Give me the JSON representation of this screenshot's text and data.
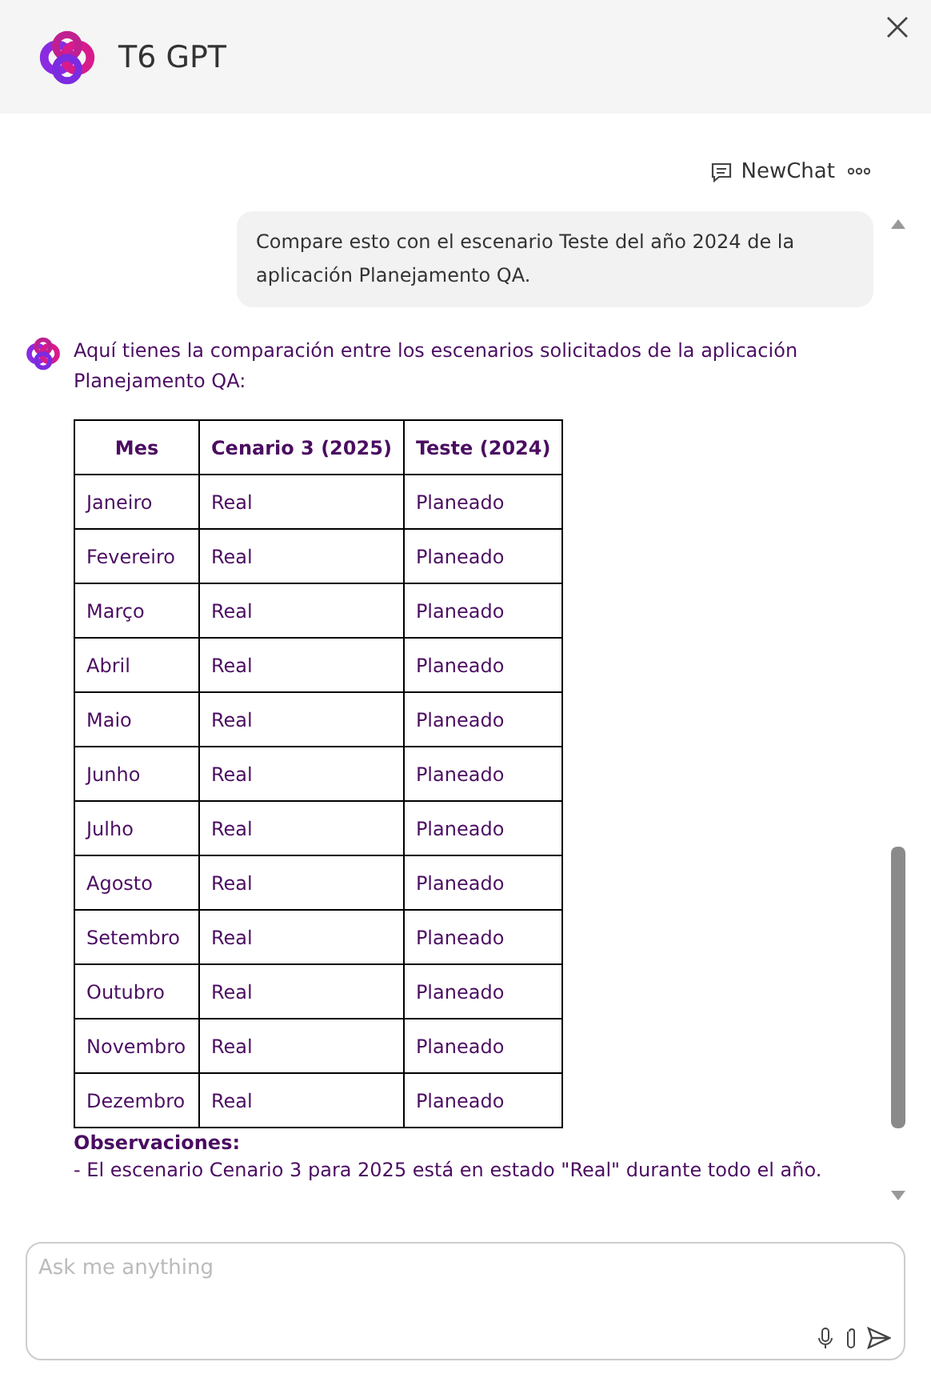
{
  "header": {
    "title": "T6 GPT"
  },
  "toolbar": {
    "new_chat": "NewChat"
  },
  "messages": [
    {
      "kind": "user",
      "text": "Compare esto con el escenario Teste del año 2024 de la aplicación Planejamento QA."
    },
    {
      "kind": "bot",
      "intro": "Aquí tienes la comparación entre los escenarios solicitados de la aplicación Planejamento QA:",
      "table": {
        "columns": [
          "Mes",
          "Cenario 3 (2025)",
          "Teste (2024)"
        ],
        "rows": [
          [
            "Janeiro",
            "Real",
            "Planeado"
          ],
          [
            "Fevereiro",
            "Real",
            "Planeado"
          ],
          [
            "Março",
            "Real",
            "Planeado"
          ],
          [
            "Abril",
            "Real",
            "Planeado"
          ],
          [
            "Maio",
            "Real",
            "Planeado"
          ],
          [
            "Junho",
            "Real",
            "Planeado"
          ],
          [
            "Julho",
            "Real",
            "Planeado"
          ],
          [
            "Agosto",
            "Real",
            "Planeado"
          ],
          [
            "Setembro",
            "Real",
            "Planeado"
          ],
          [
            "Outubro",
            "Real",
            "Planeado"
          ],
          [
            "Novembro",
            "Real",
            "Planeado"
          ],
          [
            "Dezembro",
            "Real",
            "Planeado"
          ]
        ]
      },
      "notes_title": "Observaciones:",
      "notes": [
        "- El escenario Cenario 3 para 2025 está en estado \"Real\" durante todo el año."
      ]
    }
  ],
  "composer": {
    "placeholder": "Ask me anything"
  }
}
